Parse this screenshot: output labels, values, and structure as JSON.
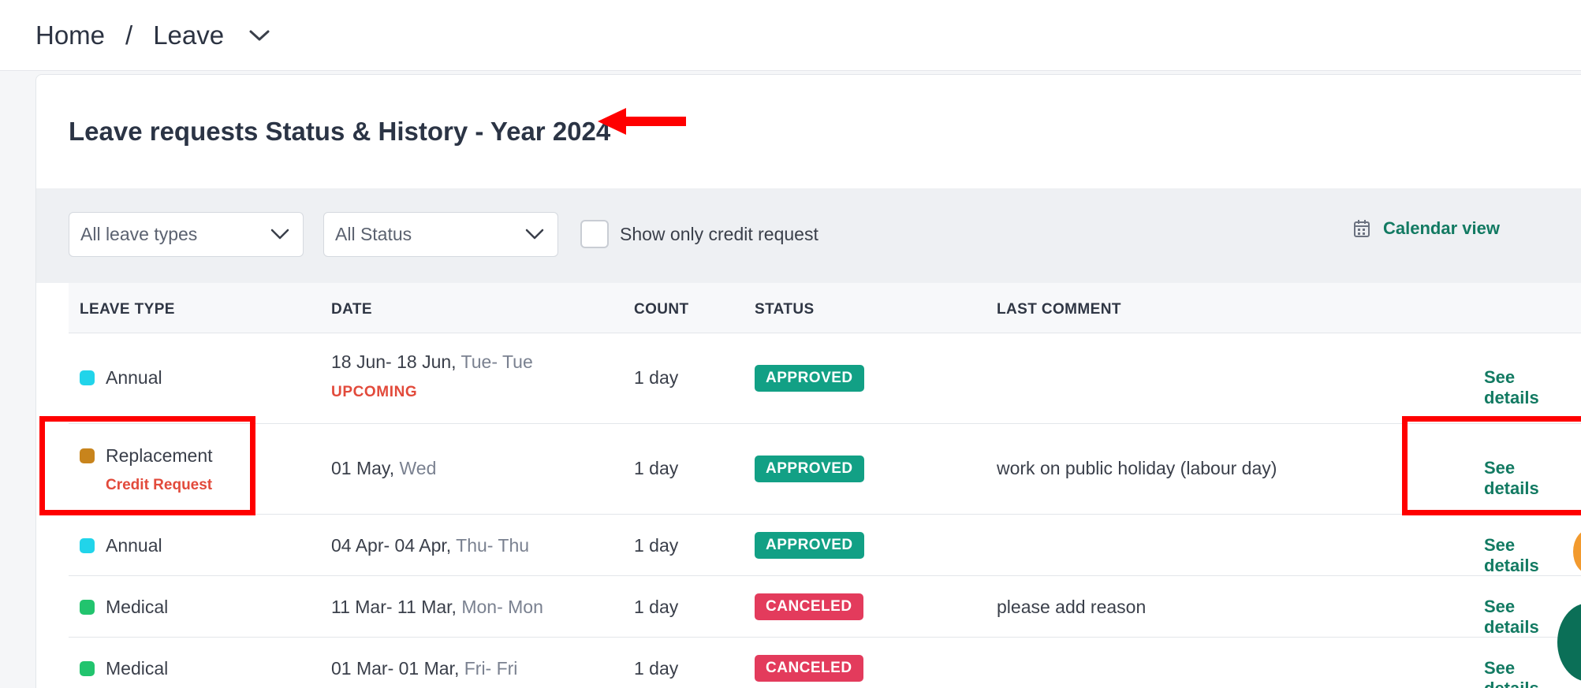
{
  "breadcrumb": {
    "home": "Home",
    "separator": "/",
    "current": "Leave"
  },
  "page": {
    "title": "Leave requests Status & History - Year 2024"
  },
  "filters": {
    "leave_type": "All leave types",
    "status": "All Status",
    "credit_only_label": "Show only credit request",
    "credit_only_checked": false,
    "calendar_view": "Calendar view"
  },
  "table": {
    "columns": [
      "LEAVE TYPE",
      "DATE",
      "COUNT",
      "STATUS",
      "LAST COMMENT"
    ],
    "rows": [
      {
        "type": "Annual",
        "type_color": "#21d4ea",
        "sub": "",
        "date": "18 Jun- 18 Jun",
        "days": "Tue- Tue",
        "tag": "UPCOMING",
        "count": "1 day",
        "status": "APPROVED",
        "comment": "",
        "action": "See details"
      },
      {
        "type": "Replacement",
        "type_color": "#c8841c",
        "sub": "Credit Request",
        "date": "01 May",
        "days": "Wed",
        "tag": "",
        "count": "1 day",
        "status": "APPROVED",
        "comment": "work on public holiday (labour day)",
        "action": "See details"
      },
      {
        "type": "Annual",
        "type_color": "#21d4ea",
        "sub": "",
        "date": "04 Apr- 04 Apr",
        "days": "Thu- Thu",
        "tag": "",
        "count": "1 day",
        "status": "APPROVED",
        "comment": "",
        "action": "See details"
      },
      {
        "type": "Medical",
        "type_color": "#22c46e",
        "sub": "",
        "date": "11 Mar- 11 Mar",
        "days": "Mon- Mon",
        "tag": "",
        "count": "1 day",
        "status": "CANCELED",
        "comment": "please add reason",
        "action": "See details"
      },
      {
        "type": "Medical",
        "type_color": "#22c46e",
        "sub": "",
        "date": "01 Mar- 01 Mar",
        "days": "Fri- Fri",
        "tag": "",
        "count": "1 day",
        "status": "CANCELED",
        "comment": "",
        "action": "See details"
      }
    ]
  },
  "colors": {
    "accent": "#127a62",
    "approved": "#12a085",
    "canceled": "#e33b5c",
    "highlight": "#ff0000"
  },
  "icons": [
    "chevron-down-icon",
    "calendar-icon",
    "chevron-right-icon",
    "red-arrow-icon"
  ]
}
